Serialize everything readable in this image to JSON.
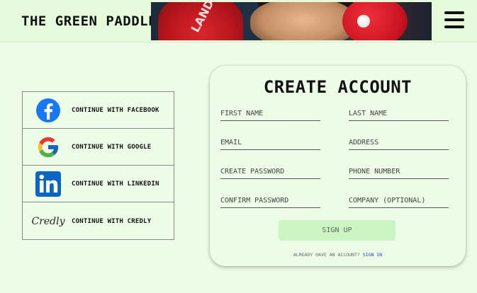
{
  "header": {
    "brand": "THE GREEN PADDLE",
    "banner_text": "LAND",
    "menu_icon": "hamburger-menu-icon"
  },
  "social": {
    "items": [
      {
        "icon": "facebook-icon",
        "label": "CONTINUE WITH FACEBOOK"
      },
      {
        "icon": "google-icon",
        "label": "CONTINUE WITH GOOGLE"
      },
      {
        "icon": "linkedin-icon",
        "label": "CONTINUE WITH LINKEDIN"
      },
      {
        "icon": "credly-logo",
        "label": "CONTINUE WITH CREDLY",
        "logo_text": "Credly"
      }
    ]
  },
  "form": {
    "title": "CREATE ACCOUNT",
    "first_name_placeholder": "FIRST NAME",
    "last_name_placeholder": "LAST NAME",
    "email_placeholder": "EMAIL",
    "address_placeholder": "ADDRESS",
    "create_password_placeholder": "CREATE PASSWORD",
    "phone_placeholder": "PHONE NUMBER",
    "confirm_password_placeholder": "CONFIRM PASSWORD",
    "company_placeholder": "COMPANY (OPTIONAL)",
    "signup_label": "SIGN UP",
    "already_text": "ALREADY HAVE AN ACCOUNT?",
    "signin_label": "SIGN IN"
  },
  "colors": {
    "background": "#ecfce6",
    "header": "#e6fbdc",
    "signup_button": "#ccf5c4",
    "link": "#1a3fd8",
    "facebook": "#1877f2",
    "linkedin": "#0a66c2"
  }
}
